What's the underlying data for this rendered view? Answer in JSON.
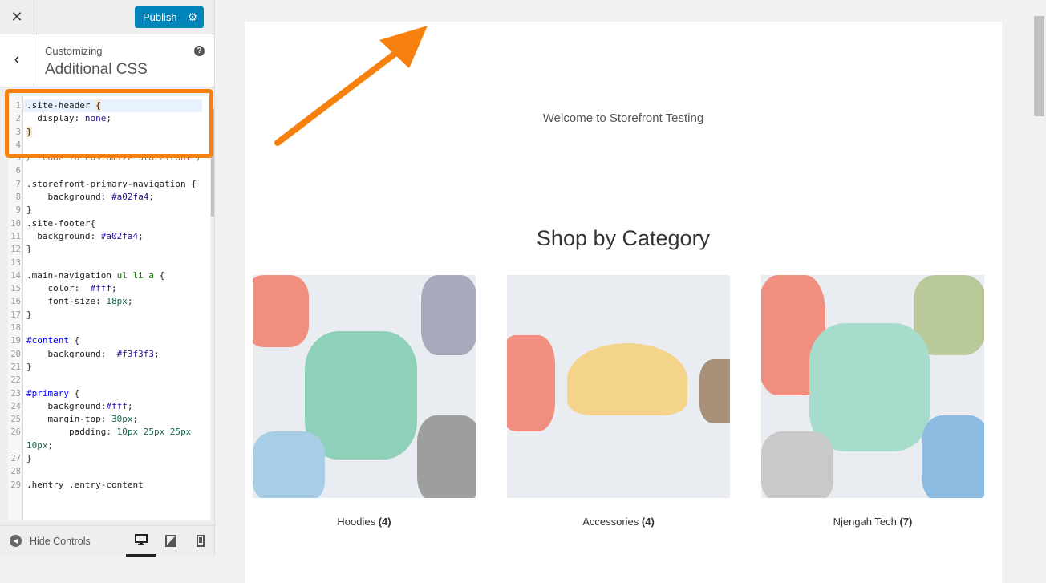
{
  "sidebar": {
    "close_icon": "close-icon",
    "publish_label": "Publish",
    "publish_settings_icon": "gear-icon",
    "customizing_label": "Customizing",
    "section_title": "Additional CSS",
    "help_icon": "?",
    "hide_controls_label": "Hide Controls",
    "devices": [
      {
        "name": "desktop",
        "active": true
      },
      {
        "name": "tablet",
        "active": false
      },
      {
        "name": "mobile",
        "active": false
      }
    ]
  },
  "editor": {
    "lines": [
      {
        "n": "1",
        "active": true,
        "tokens": [
          [
            ".site-header ",
            ""
          ],
          [
            "{",
            "k-br"
          ]
        ]
      },
      {
        "n": "2",
        "tokens": [
          [
            "  display: ",
            ""
          ],
          [
            "none",
            "k-pr"
          ],
          [
            ";",
            ""
          ]
        ]
      },
      {
        "n": "3",
        "tokens": [
          [
            "}",
            "k-br"
          ]
        ]
      },
      {
        "n": "4",
        "tokens": []
      },
      {
        "n": "5",
        "tokens": [
          [
            "/* Code to customize Storefront*/",
            "k-com"
          ]
        ]
      },
      {
        "n": "6",
        "tokens": []
      },
      {
        "n": "7",
        "tokens": [
          [
            ".storefront-primary-navigation {",
            ""
          ]
        ]
      },
      {
        "n": "8",
        "tokens": [
          [
            "    background: ",
            ""
          ],
          [
            "#a02fa4",
            "k-pr"
          ],
          [
            ";",
            ""
          ]
        ]
      },
      {
        "n": "9",
        "tokens": [
          [
            "}",
            ""
          ]
        ]
      },
      {
        "n": "10",
        "tokens": [
          [
            ".site-footer{",
            ""
          ]
        ]
      },
      {
        "n": "11",
        "tokens": [
          [
            "  background: ",
            ""
          ],
          [
            "#a02fa4",
            "k-pr"
          ],
          [
            ";",
            ""
          ]
        ]
      },
      {
        "n": "12",
        "tokens": [
          [
            "}",
            ""
          ]
        ]
      },
      {
        "n": "13",
        "tokens": []
      },
      {
        "n": "14",
        "tokens": [
          [
            ".main-navigation ",
            ""
          ],
          [
            "ul li a",
            "k-tag"
          ],
          [
            " {",
            ""
          ]
        ]
      },
      {
        "n": "15",
        "tokens": [
          [
            "    color:  ",
            ""
          ],
          [
            "#fff",
            "k-pr"
          ],
          [
            ";",
            ""
          ]
        ]
      },
      {
        "n": "16",
        "tokens": [
          [
            "    font-size: ",
            ""
          ],
          [
            "18px",
            "k-num"
          ],
          [
            ";",
            ""
          ]
        ]
      },
      {
        "n": "17",
        "tokens": [
          [
            "}",
            ""
          ]
        ]
      },
      {
        "n": "18",
        "tokens": []
      },
      {
        "n": "19",
        "tokens": [
          [
            "#content",
            "k-id"
          ],
          [
            " {",
            ""
          ]
        ]
      },
      {
        "n": "20",
        "tokens": [
          [
            "    background:  ",
            ""
          ],
          [
            "#f3f3f3",
            "k-pr"
          ],
          [
            ";",
            ""
          ]
        ]
      },
      {
        "n": "21",
        "tokens": [
          [
            "}",
            ""
          ]
        ]
      },
      {
        "n": "22",
        "tokens": []
      },
      {
        "n": "23",
        "tokens": [
          [
            "#primary",
            "k-id"
          ],
          [
            " {",
            ""
          ]
        ]
      },
      {
        "n": "24",
        "tokens": [
          [
            "    background:",
            ""
          ],
          [
            "#fff",
            "k-pr"
          ],
          [
            ";",
            ""
          ]
        ]
      },
      {
        "n": "25",
        "tokens": [
          [
            "    margin-top: ",
            ""
          ],
          [
            "30px",
            "k-num"
          ],
          [
            ";",
            ""
          ]
        ]
      },
      {
        "n": "26",
        "tokens": [
          [
            "        padding: ",
            ""
          ],
          [
            "10px 25px 25px 10px",
            "k-num"
          ],
          [
            ";",
            ""
          ]
        ]
      },
      {
        "n": "27",
        "tokens": [
          [
            "}",
            ""
          ]
        ]
      },
      {
        "n": "28",
        "tokens": []
      },
      {
        "n": "29",
        "tokens": [
          [
            ".hentry .entry-content",
            ""
          ]
        ]
      }
    ]
  },
  "preview": {
    "welcome": "Welcome to Storefront Testing",
    "section_title": "Shop by Category",
    "categories": [
      {
        "name": "Hoodies",
        "count": "(4)"
      },
      {
        "name": "Accessories",
        "count": "(4)"
      },
      {
        "name": "Njengah Tech",
        "count": "(7)"
      }
    ]
  },
  "colors": {
    "publish": "#0085ba",
    "highlight": "#f7810e"
  }
}
